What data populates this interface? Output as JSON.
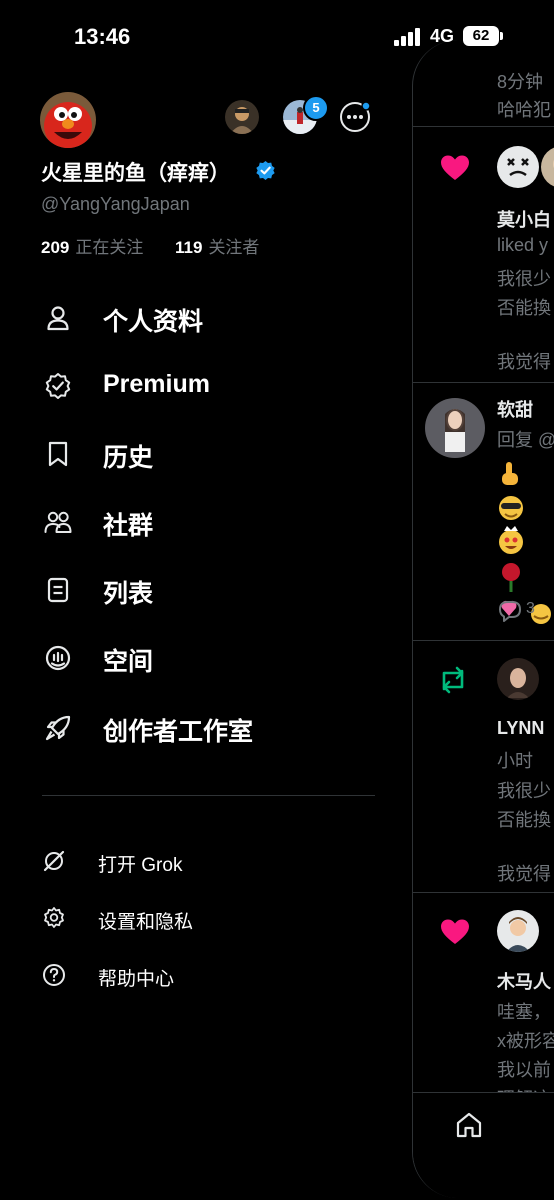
{
  "status_bar": {
    "time": "13:46",
    "network": "4G",
    "battery": "62"
  },
  "profile": {
    "display_name": "火星里的鱼（痒痒）",
    "handle": "@YangYangJapan",
    "following_count": "209",
    "following_label": "正在关注",
    "followers_count": "119",
    "followers_label": "关注者",
    "notification_badge": "5"
  },
  "nav": {
    "items": [
      {
        "label": "个人资料",
        "icon": "person-icon"
      },
      {
        "label": "Premium",
        "icon": "premium-badge-icon"
      },
      {
        "label": "历史",
        "icon": "bookmark-icon"
      },
      {
        "label": "社群",
        "icon": "communities-icon"
      },
      {
        "label": "列表",
        "icon": "list-icon"
      },
      {
        "label": "空间",
        "icon": "spaces-icon"
      },
      {
        "label": "创作者工作室",
        "icon": "rocket-icon"
      }
    ],
    "secondary": [
      {
        "label": "打开 Grok",
        "icon": "grok-icon"
      },
      {
        "label": "设置和隐私",
        "icon": "gear-icon"
      },
      {
        "label": "帮助中心",
        "icon": "help-icon"
      }
    ]
  },
  "feed": {
    "t1": "8分钟",
    "t2": "哈哈犯",
    "t3": "莫小白",
    "t4": "liked y",
    "t5": "我很少",
    "t6": "否能換",
    "t7": "我觉得",
    "t8": "软甜",
    "t9": "回复 @",
    "t10": "3",
    "t11": "LYNN",
    "t12": "小时",
    "t13": "我很少",
    "t14": "否能換",
    "t15": "我觉得",
    "t16": "木马人",
    "t17": "哇塞，",
    "t18": "x被形容",
    "t19": "我以前",
    "t20": "理解这"
  },
  "colors": {
    "accent": "#1d9bf0",
    "like": "#f91880",
    "retweet": "#00ba7c"
  }
}
